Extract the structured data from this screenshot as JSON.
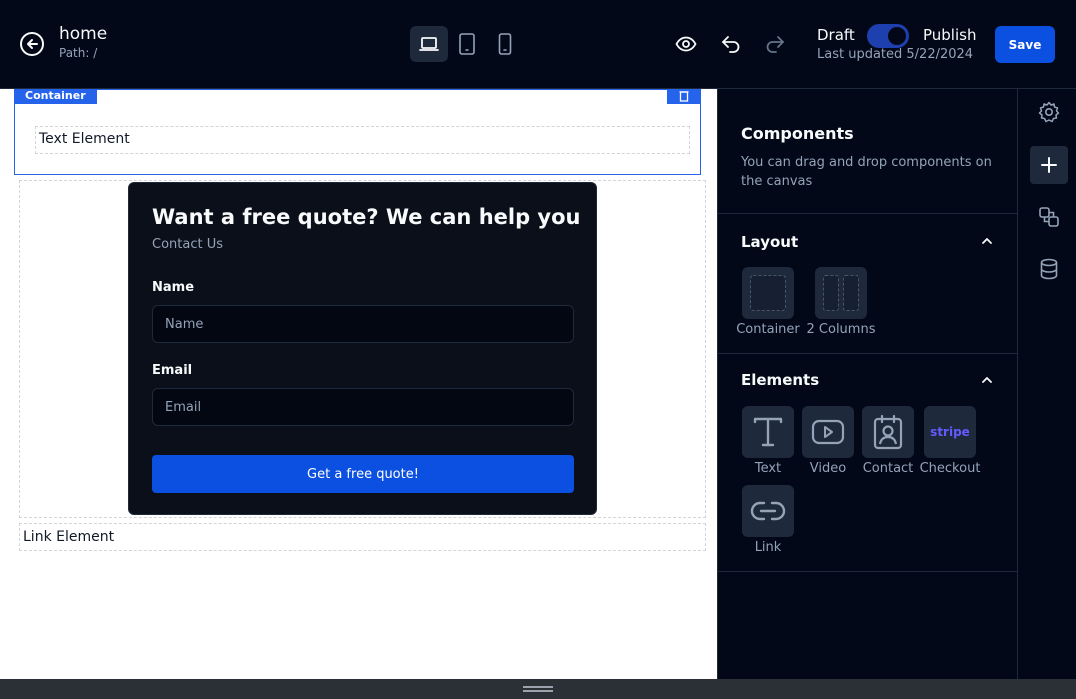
{
  "header": {
    "page_name": "home",
    "page_path": "Path: /",
    "draft_label": "Draft",
    "publish_label": "Publish",
    "last_updated": "Last updated 5/22/2024",
    "save_label": "Save",
    "publish_toggle_on": true,
    "active_device": "desktop"
  },
  "canvas": {
    "container_tag": "Container",
    "text_element": "Text Element",
    "contact_card": {
      "title": "Want a free quote? We can help you",
      "subtitle": "Contact Us",
      "name_label": "Name",
      "name_placeholder": "Name",
      "email_label": "Email",
      "email_placeholder": "Email",
      "submit_label": "Get a free quote!"
    },
    "link_element": "Link Element"
  },
  "panel": {
    "title": "Components",
    "description": "You can drag and drop components on the canvas",
    "layout": {
      "title": "Layout",
      "items": [
        {
          "label": "Container",
          "icon": "container-icon"
        },
        {
          "label": "2 Columns",
          "icon": "two-columns-icon"
        }
      ]
    },
    "elements": {
      "title": "Elements",
      "items": [
        {
          "label": "Text",
          "icon": "text-icon"
        },
        {
          "label": "Video",
          "icon": "video-icon"
        },
        {
          "label": "Contact",
          "icon": "contact-icon"
        },
        {
          "label": "Checkout",
          "icon": "stripe-icon",
          "icon_text": "stripe"
        },
        {
          "label": "Link",
          "icon": "link-icon"
        }
      ]
    }
  },
  "rail": {
    "items": [
      "settings-icon",
      "plus-icon",
      "layers-icon",
      "database-icon"
    ],
    "active": "plus-icon"
  },
  "colors": {
    "background": "#020817",
    "accent": "#0b50e0",
    "selection": "#2563eb",
    "stripe": "#635bff",
    "muted_text": "#94a3b8"
  }
}
